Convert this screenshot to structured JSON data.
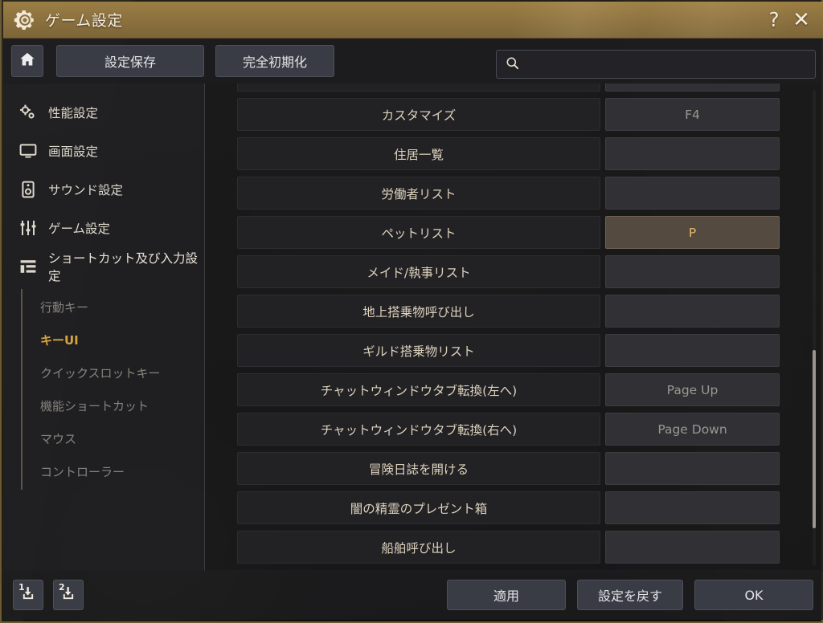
{
  "window": {
    "title": "ゲーム設定",
    "gear_icon": "gear-icon",
    "help_label": "?",
    "close_label": "✕"
  },
  "toolbar": {
    "home_icon": "home-icon",
    "save_label": "設定保存",
    "reset_label": "完全初期化"
  },
  "search": {
    "icon": "search-icon",
    "value": "",
    "placeholder": ""
  },
  "sidebar": {
    "items": [
      {
        "label": "性能設定",
        "icon": "performance-gears-icon",
        "active": false
      },
      {
        "label": "画面設定",
        "icon": "monitor-icon",
        "active": false
      },
      {
        "label": "サウンド設定",
        "icon": "speaker-icon",
        "active": false
      },
      {
        "label": "ゲーム設定",
        "icon": "sliders-icon",
        "active": false
      },
      {
        "label": "ショートカット及び入力設定",
        "icon": "list-icon",
        "active": true
      }
    ],
    "subitems": [
      {
        "label": "行動キー",
        "active": false
      },
      {
        "label": "キーUI",
        "active": true
      },
      {
        "label": "クイックスロットキー",
        "active": false
      },
      {
        "label": "機能ショートカット",
        "active": false
      },
      {
        "label": "マウス",
        "active": false
      },
      {
        "label": "コントローラー",
        "active": false
      }
    ]
  },
  "main": {
    "rows": [
      {
        "label": "",
        "key": "",
        "state": "clipped"
      },
      {
        "label": "カスタマイズ",
        "key": "F4",
        "state": "assigned"
      },
      {
        "label": "住居一覧",
        "key": "",
        "state": "empty"
      },
      {
        "label": "労働者リスト",
        "key": "",
        "state": "empty"
      },
      {
        "label": "ペットリスト",
        "key": "P",
        "state": "highlight"
      },
      {
        "label": "メイド/執事リスト",
        "key": "",
        "state": "empty"
      },
      {
        "label": "地上搭乗物呼び出し",
        "key": "",
        "state": "empty"
      },
      {
        "label": "ギルド搭乗物リスト",
        "key": "",
        "state": "empty"
      },
      {
        "label": "チャットウィンドウタブ転換(左へ)",
        "key": "Page Up",
        "state": "assigned"
      },
      {
        "label": "チャットウィンドウタブ転換(右へ)",
        "key": "Page Down",
        "state": "assigned"
      },
      {
        "label": "冒険日誌を開ける",
        "key": "",
        "state": "empty"
      },
      {
        "label": "闇の精霊のプレゼント箱",
        "key": "",
        "state": "empty"
      },
      {
        "label": "船舶呼び出し",
        "key": "",
        "state": "empty"
      }
    ]
  },
  "footer": {
    "preset1_num": "1",
    "preset2_num": "2",
    "preset_icon": "save-download-icon",
    "apply_label": "適用",
    "revert_label": "設定を戻す",
    "ok_label": "OK"
  },
  "colors": {
    "title_gold": "#8d7240",
    "accent_gold": "#d6a53f",
    "highlight_key_bg": "#554a40",
    "highlight_key_text": "#e0b569",
    "panel_dark": "#222124",
    "button_gray": "#3a3c45"
  }
}
